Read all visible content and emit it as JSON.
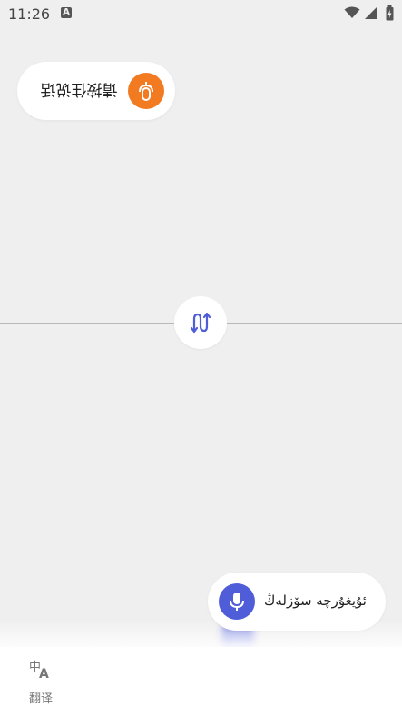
{
  "status_bar": {
    "time": "11:26",
    "notification_icon": "A"
  },
  "top_panel": {
    "prompt_text": "请按住说话",
    "mic_icon": "mic-icon",
    "accent_color": "#f27a21",
    "rotated": true
  },
  "swap": {
    "icon": "swap-icon"
  },
  "bottom_panel": {
    "prompt_text": "ئۇيغۇرچە سۆزلەڭ",
    "mic_icon": "mic-icon",
    "accent_color": "#4f5dd8"
  },
  "bottom_nav": {
    "items": [
      {
        "label": "翻译",
        "icon": "translate-icon",
        "selected": true
      }
    ]
  }
}
